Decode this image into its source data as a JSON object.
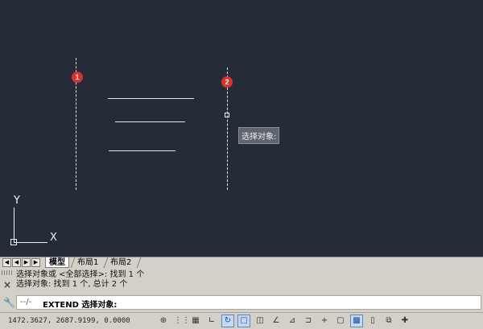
{
  "canvas": {
    "tooltip_text": "选择对象:",
    "markers": [
      "1",
      "2"
    ],
    "ucs": {
      "y_label": "Y",
      "x_label": "X"
    }
  },
  "tabs": {
    "nav_buttons": [
      "◀",
      "◀",
      "▶",
      "▶"
    ],
    "items": [
      {
        "label": "模型",
        "active": true
      },
      {
        "label": "布局1",
        "active": false
      },
      {
        "label": "布局2",
        "active": false
      }
    ]
  },
  "command": {
    "history": [
      "选择对象或 <全部选择>: 找到 1 个",
      "选择对象: 找到 1 个, 总计 2 个"
    ],
    "prompt_icon": "--/-",
    "current_prompt": "EXTEND 选择对象:",
    "close_icon": "×",
    "settings_icon": "wrench-icon"
  },
  "status": {
    "coordinates": "1472.3627, 2687.9199, 0.0000",
    "buttons": [
      {
        "name": "model-space-icon",
        "glyph": "⊕",
        "on": false
      },
      {
        "name": "snap-icon",
        "glyph": "⋮⋮",
        "on": false
      },
      {
        "name": "grid-icon",
        "glyph": "▦",
        "on": false
      },
      {
        "name": "ortho-icon",
        "glyph": "∟",
        "on": false
      },
      {
        "name": "polar-icon",
        "glyph": "↻",
        "on": true
      },
      {
        "name": "osnap-icon",
        "glyph": "□",
        "on": true
      },
      {
        "name": "3d-osnap-icon",
        "glyph": "◫",
        "on": false
      },
      {
        "name": "otrack-icon",
        "glyph": "∠",
        "on": false
      },
      {
        "name": "ducs-icon",
        "glyph": "⊿",
        "on": false
      },
      {
        "name": "dyn-icon",
        "glyph": "⊐",
        "on": false
      },
      {
        "name": "lineweight-icon",
        "glyph": "+",
        "on": false
      },
      {
        "name": "transparency-icon",
        "glyph": "▢",
        "on": false
      },
      {
        "name": "quick-properties-icon",
        "glyph": "▩",
        "on": true
      },
      {
        "name": "selection-cycling-icon",
        "glyph": "▯",
        "on": false
      },
      {
        "name": "annotation-monitor-icon",
        "glyph": "⧉",
        "on": false
      },
      {
        "name": "add-icon",
        "glyph": "✚",
        "on": false
      }
    ]
  }
}
